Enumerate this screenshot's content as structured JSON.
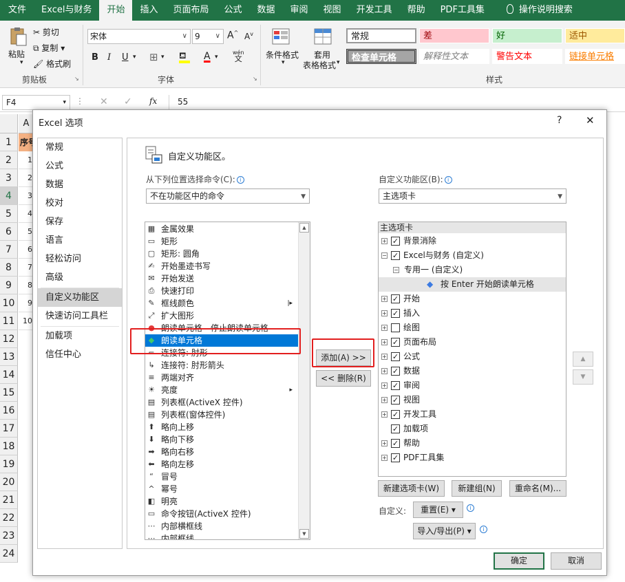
{
  "ribbon_tabs": [
    "文件",
    "Excel与财务",
    "开始",
    "插入",
    "页面布局",
    "公式",
    "数据",
    "审阅",
    "视图",
    "开发工具",
    "帮助",
    "PDF工具集",
    "操作说明搜索"
  ],
  "clipboard": {
    "paste": "粘贴",
    "cut": "剪切",
    "copy": "复制",
    "format_painter": "格式刷",
    "group": "剪贴板"
  },
  "font": {
    "name": "宋体",
    "size": "9",
    "group": "字体",
    "bold": "B",
    "italic": "I",
    "underline": "U",
    "grow": "A",
    "shrink": "A",
    "wen": "wén",
    "wen2": "文"
  },
  "styles": {
    "cond_format": "条件格式",
    "table_format_1": "套用",
    "table_format_2": "表格格式",
    "group": "样式",
    "cells": [
      {
        "text": "常规",
        "color": "#222222",
        "bg": "#ffffff"
      },
      {
        "text": "差",
        "color": "#9c0006",
        "bg": "#ffc7ce"
      },
      {
        "text": "好",
        "color": "#006100",
        "bg": "#c6efce"
      },
      {
        "text": "适中",
        "color": "#9c5700",
        "bg": "#ffeb9c"
      },
      {
        "text": "检查单元格",
        "color": "#ffffff",
        "bg": "#a5a5a5"
      },
      {
        "text": "解释性文本",
        "color": "#7f7f7f",
        "bg": "#ffffff"
      },
      {
        "text": "警告文本",
        "color": "#ff0000",
        "bg": "#ffffff"
      },
      {
        "text": "链接单元格",
        "color": "#fa7d00",
        "bg": "#ffffff"
      }
    ]
  },
  "formula_bar": {
    "name_box": "F4",
    "fx": "fx",
    "value": "55"
  },
  "sheet": {
    "col_header": "A",
    "header_cell": "序号",
    "rows": [
      "1",
      "2",
      "3",
      "4",
      "5",
      "6",
      "7",
      "8",
      "9",
      "10",
      "11",
      "12",
      "13",
      "14",
      "15",
      "16",
      "17",
      "18",
      "19",
      "20",
      "21",
      "22",
      "23",
      "24"
    ],
    "values": [
      "",
      "1",
      "2",
      "3",
      "4",
      "5",
      "6",
      "7",
      "8",
      "9",
      "10"
    ],
    "selected_row": "4"
  },
  "dialog": {
    "title": "Excel 选项",
    "help": "?",
    "close": "✕",
    "nav": [
      "常规",
      "公式",
      "数据",
      "校对",
      "保存",
      "语言",
      "轻松访问",
      "高级",
      "自定义功能区",
      "快速访问工具栏",
      "加载项",
      "信任中心"
    ],
    "nav_selected": "自定义功能区",
    "heading": "自定义功能区。",
    "choose_label": "从下列位置选择命令(C):",
    "choose_value": "不在功能区中的命令",
    "customize_label": "自定义功能区(B):",
    "customize_value": "主选项卡",
    "commands": [
      {
        "icon": "▦",
        "label": "金属效果"
      },
      {
        "icon": "▭",
        "label": "矩形"
      },
      {
        "icon": "▢",
        "label": "矩形: 圆角"
      },
      {
        "icon": "✍",
        "label": "开始墨迹书写"
      },
      {
        "icon": "✉",
        "label": "开始发送"
      },
      {
        "icon": "⎙",
        "label": "快速打印"
      },
      {
        "icon": "✎",
        "label": "框线颜色",
        "sub": "|▸"
      },
      {
        "icon": "⤢",
        "label": "扩大图形"
      },
      {
        "icon": "●",
        "label": "朗读单元格 - 停止朗读单元格"
      },
      {
        "icon": "◆",
        "label": "朗读单元格"
      },
      {
        "icon": "⌐",
        "label": "连接符: 肘形"
      },
      {
        "icon": "↳",
        "label": "连接符: 肘形箭头"
      },
      {
        "icon": "≡",
        "label": "两端对齐"
      },
      {
        "icon": "☀",
        "label": "亮度",
        "sub": "▸"
      },
      {
        "icon": "▤",
        "label": "列表框(ActiveX 控件)"
      },
      {
        "icon": "▤",
        "label": "列表框(窗体控件)"
      },
      {
        "icon": "⬆",
        "label": "略向上移"
      },
      {
        "icon": "⬇",
        "label": "略向下移"
      },
      {
        "icon": "➡",
        "label": "略向右移"
      },
      {
        "icon": "⬅",
        "label": "略向左移"
      },
      {
        "icon": "“",
        "label": "冒号"
      },
      {
        "icon": "^",
        "label": "幂号"
      },
      {
        "icon": "◧",
        "label": "明亮"
      },
      {
        "icon": "▭",
        "label": "命令按钮(ActiveX 控件)"
      },
      {
        "icon": "⋯",
        "label": "内部横框线"
      },
      {
        "icon": "⋯",
        "label": "内部框线"
      }
    ],
    "selected_command": "朗读单元格",
    "add_button": "添加(A) >>",
    "remove_button": "<< 删除(R)",
    "tree_header": "主选项卡",
    "tree": [
      {
        "label": "背景消除",
        "exp": "+",
        "chk": true,
        "lvl": 0
      },
      {
        "label": "Excel与财务 (自定义)",
        "exp": "−",
        "chk": true,
        "lvl": 0
      },
      {
        "label": "专用一 (自定义)",
        "exp": "−",
        "chk": null,
        "lvl": 1
      },
      {
        "label": "按 Enter 开始朗读单元格",
        "exp": null,
        "chk": null,
        "lvl": 2,
        "sel": true
      },
      {
        "label": "开始",
        "exp": "+",
        "chk": true,
        "lvl": 0
      },
      {
        "label": "插入",
        "exp": "+",
        "chk": true,
        "lvl": 0
      },
      {
        "label": "绘图",
        "exp": "+",
        "chk": false,
        "lvl": 0
      },
      {
        "label": "页面布局",
        "exp": "+",
        "chk": true,
        "lvl": 0
      },
      {
        "label": "公式",
        "exp": "+",
        "chk": true,
        "lvl": 0
      },
      {
        "label": "数据",
        "exp": "+",
        "chk": true,
        "lvl": 0
      },
      {
        "label": "审阅",
        "exp": "+",
        "chk": true,
        "lvl": 0
      },
      {
        "label": "视图",
        "exp": "+",
        "chk": true,
        "lvl": 0
      },
      {
        "label": "开发工具",
        "exp": "+",
        "chk": true,
        "lvl": 0
      },
      {
        "label": "加载项",
        "exp": null,
        "chk": true,
        "lvl": 0
      },
      {
        "label": "帮助",
        "exp": "+",
        "chk": true,
        "lvl": 0
      },
      {
        "label": "PDF工具集",
        "exp": "+",
        "chk": true,
        "lvl": 0
      }
    ],
    "new_tab": "新建选项卡(W)",
    "new_group": "新建组(N)",
    "rename": "重命名(M)...",
    "customize": "自定义:",
    "reset": "重置(E) ▾",
    "import_export": "导入/导出(P) ▾",
    "ok": "确定",
    "cancel": "取消"
  },
  "colors": {
    "excel_green": "#217346",
    "selection_blue": "#0078d7",
    "highlight_red": "#e21e1e",
    "header_orange": "#f4b183"
  }
}
